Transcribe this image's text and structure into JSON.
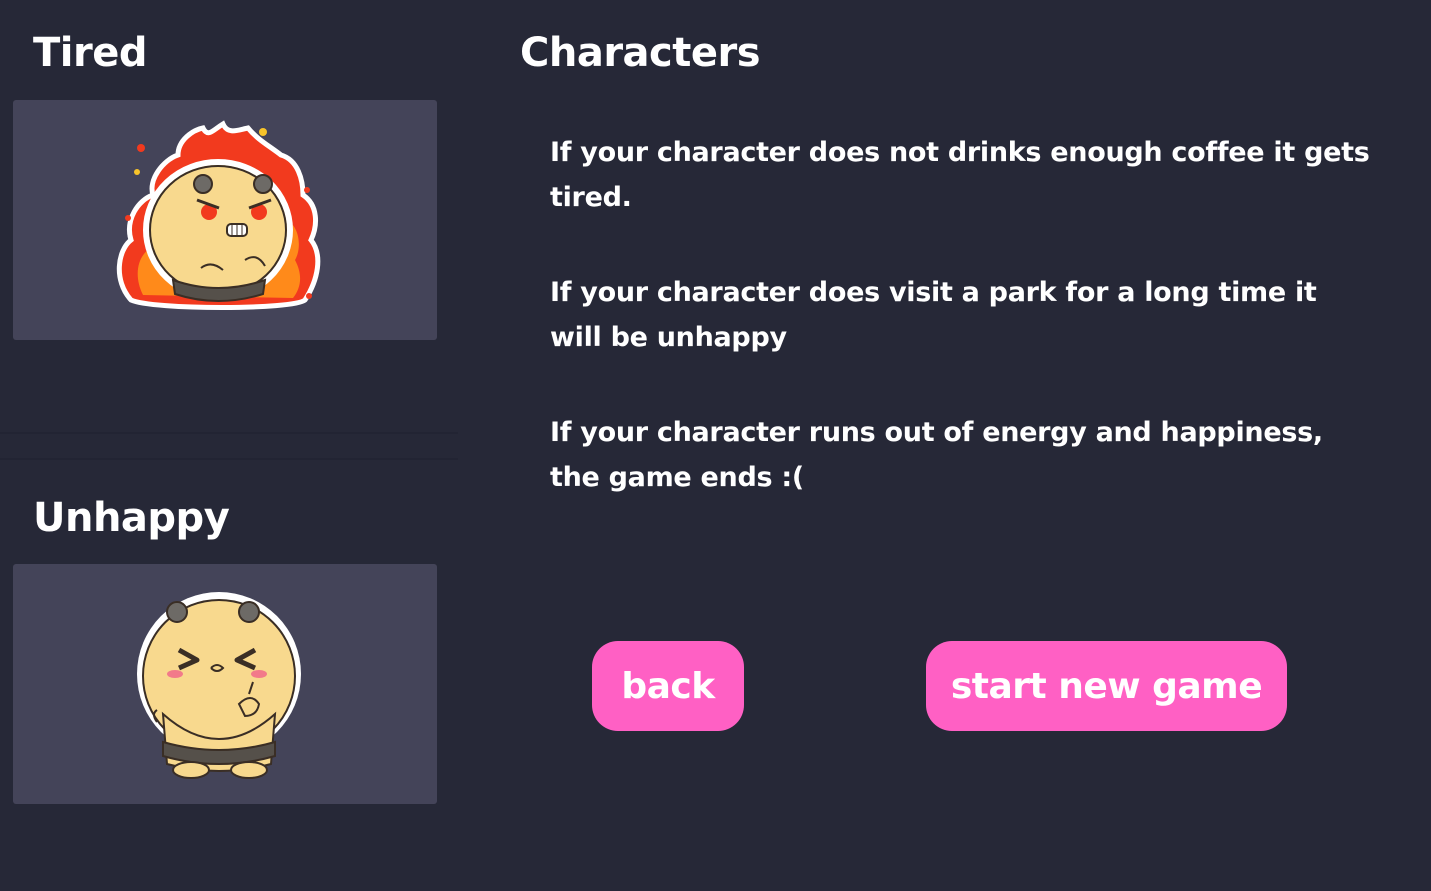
{
  "moods": {
    "tired": {
      "title": "Tired"
    },
    "unhappy": {
      "title": "Unhappy"
    }
  },
  "characters": {
    "title": "Characters",
    "rules": [
      "If your character does not drinks enough coffee it gets tired.",
      "If your character does visit a park for a long time it will be unhappy",
      "If your character runs out of energy and happiness, the game ends :("
    ]
  },
  "buttons": {
    "back_label": "back",
    "start_label": "start new game"
  },
  "colors": {
    "background": "#262837",
    "card": "#444459",
    "button": "#ff60c4",
    "character_body": "#f8d98e",
    "flame": "#f23a1e"
  }
}
